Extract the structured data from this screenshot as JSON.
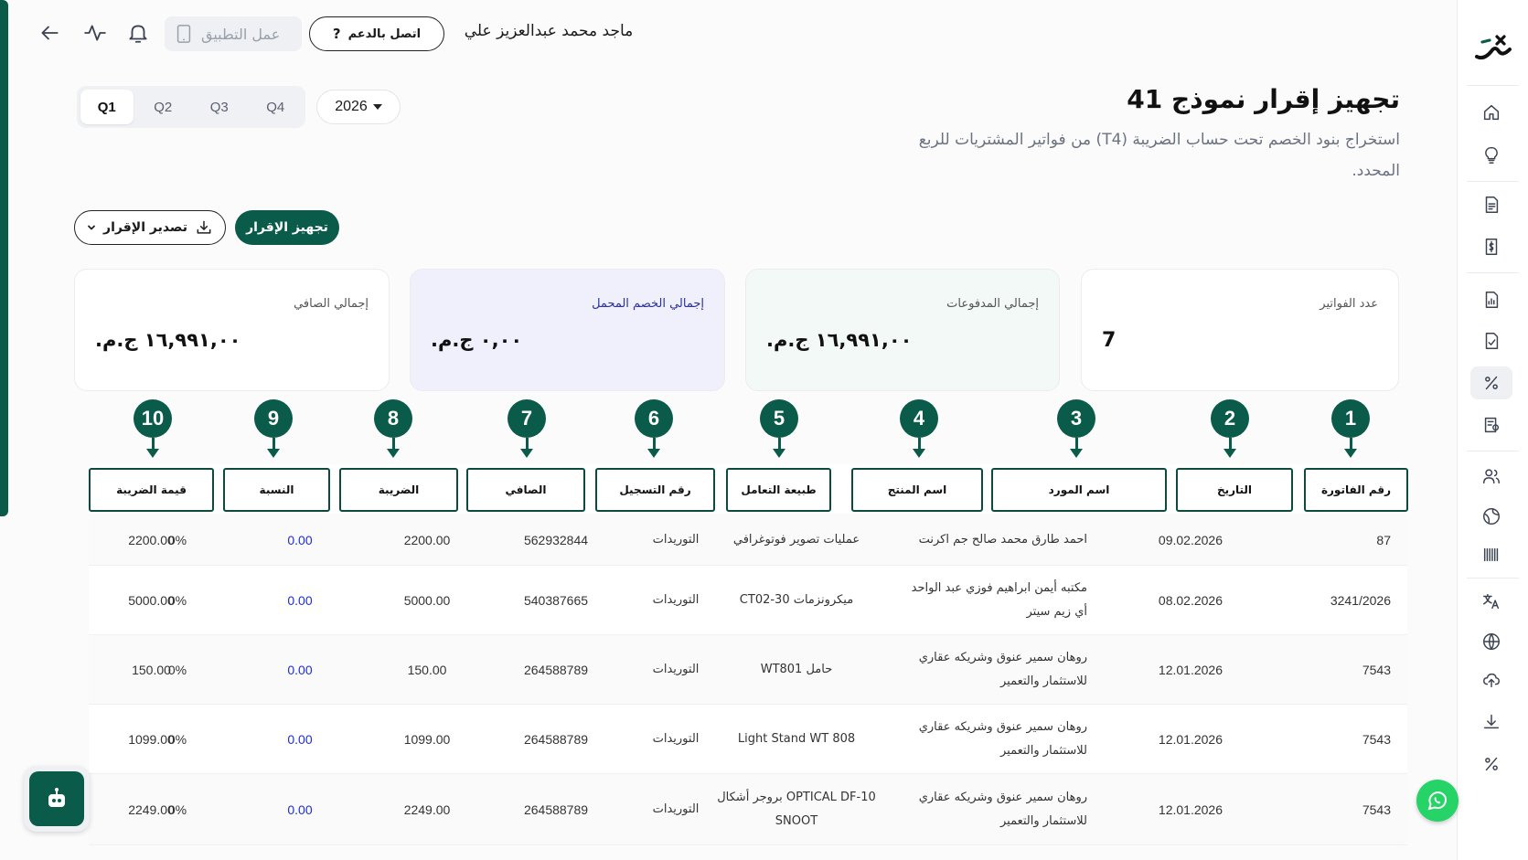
{
  "header": {
    "user_name": "ماجد محمد عبدالعزيز علي",
    "support_label": "اتصل بالدعم",
    "support_icon": "?",
    "app_label": "عمل التطبيق"
  },
  "page": {
    "title": "تجهيز إقرار نموذج 41",
    "subtitle": "استخراج بنود الخصم تحت حساب الضريبة (T4) من فواتير المشتريات للربع المحدد."
  },
  "filters": {
    "quarters": [
      "Q1",
      "Q2",
      "Q3",
      "Q4"
    ],
    "active_quarter": "Q1",
    "year": "2026"
  },
  "actions": {
    "prepare_label": "تجهيز الإقرار",
    "export_label": "تصدير الإقرار"
  },
  "stats": {
    "invoice_count_label": "عدد الفواتير",
    "invoice_count": "7",
    "payments_label": "إجمالي المدفوعات",
    "payments_value": "١٦,٩٩١,٠٠ ج.م.",
    "deduction_label": "إجمالي الخصم المحمل",
    "deduction_value": "٠,٠٠ ج.م.",
    "net_label": "إجمالي الصافي",
    "net_value": "١٦,٩٩١,٠٠ ج.م."
  },
  "markers": [
    "1",
    "2",
    "3",
    "4",
    "5",
    "6",
    "7",
    "8",
    "9",
    "10"
  ],
  "table": {
    "columns": [
      "رقم الفاتورة",
      "التاريخ",
      "اسم المورد",
      "اسم المنتج",
      "طبيعة التعامل",
      "رقم التسجيل",
      "الصافي",
      "الضريبة",
      "النسبة",
      "قيمة الضريبة"
    ],
    "rows": [
      {
        "invoice": "87",
        "date": "09.02.2026",
        "supplier": "احمد طارق محمد صالح جم اكرنت",
        "product": "عمليات تصوير فوتوغرافي",
        "nature": "التوريدات",
        "reg": "562932844",
        "net": "2200.00",
        "tax": "0.00",
        "rate": "0%",
        "tax_value": "2200.00"
      },
      {
        "invoice": "3241/2026",
        "date": "08.02.2026",
        "supplier": "مكتبه أيمن ابراهيم فوزي عبد الواحد أي زيم سيتر",
        "product": "ميكرونزمات CT02-30",
        "nature": "التوريدات",
        "reg": "540387665",
        "net": "5000.00",
        "tax": "0.00",
        "rate": "0%",
        "tax_value": "5000.00"
      },
      {
        "invoice": "7543",
        "date": "12.01.2026",
        "supplier": "روهان سمير عنوق وشريكه عقاري للاستثمار والتعمير",
        "product": "حامل WT801",
        "nature": "التوريدات",
        "reg": "264588789",
        "net": "150.00",
        "tax": "0.00",
        "rate": "0%",
        "tax_value": "150.00"
      },
      {
        "invoice": "7543",
        "date": "12.01.2026",
        "supplier": "روهان سمير عنوق وشريكه عقاري للاستثمار والتعمير",
        "product": "Light Stand WT 808",
        "nature": "التوريدات",
        "reg": "264588789",
        "net": "1099.00",
        "tax": "0.00",
        "rate": "0%",
        "tax_value": "1099.00"
      },
      {
        "invoice": "7543",
        "date": "12.01.2026",
        "supplier": "روهان سمير عنوق وشريكه عقاري للاستثمار والتعمير",
        "product": "OPTICAL DF-10 بروجر أشكال SNOOT",
        "nature": "التوريدات",
        "reg": "264588789",
        "net": "2249.00",
        "tax": "0.00",
        "rate": "0%",
        "tax_value": "2249.00"
      }
    ]
  },
  "colors": {
    "brand": "#0b5b4a",
    "tax_value": "#1d2fd6",
    "whatsapp": "#25d366"
  }
}
